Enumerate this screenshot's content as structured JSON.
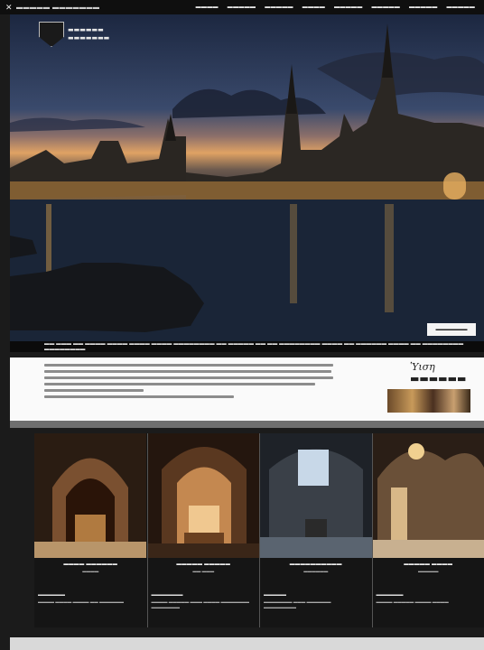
{
  "topbar": {
    "close_glyph": "✕",
    "site_name": "▬▬▬▬▬ ▬▬▬▬▬▬▬",
    "nav": [
      "▬▬▬▬",
      "▬▬▬▬▬",
      "▬▬▬▬▬",
      "▬▬▬▬",
      "▬▬▬▬▬",
      "▬▬▬▬▬",
      "▬▬▬▬▬",
      "▬▬▬▬▬"
    ]
  },
  "hero": {
    "logo_line1": "▬▬▬▬▬▬",
    "logo_line2": "▬▬▬▬▬▬▬",
    "button_label": "▬▬▬▬▬▬▬",
    "caption": "▬▬ ▬▬▬ ▬▬ ▬▬▬▬ ▬▬▬▬ ▬▬▬▬ ▬▬▬▬ ▬▬▬▬▬▬▬▬ ▬▬ ▬▬▬▬▬ ▬▬ ▬▬ ▬▬▬▬▬▬▬▬ ▬▬▬▬ ▬▬ ▬▬▬▬▬▬ ▬▬▬▬ ▬▬ ▬▬▬▬▬▬▬▬ ▬▬▬▬▬▬▬▬"
  },
  "intro": {
    "title": "Ὑιση ▬▬▬▬▬▬"
  },
  "gallery": [
    {
      "caption": "▬▬▬▬ ▬▬▬▬▬▬",
      "sub": "▬▬▬▬",
      "desc_title": "▬▬▬▬▬▬",
      "desc": "▬▬▬▬ ▬▬▬▬ ▬▬▬▬ ▬▬ ▬▬▬▬▬▬"
    },
    {
      "caption": "▬▬▬▬▬ ▬▬▬▬▬",
      "sub": "▬▬ ▬▬▬",
      "desc_title": "▬▬▬▬▬▬▬",
      "desc": "▬▬▬▬ ▬▬▬▬▬ ▬▬▬ ▬▬▬▬ ▬▬▬▬▬▬▬ ▬▬▬▬▬▬▬"
    },
    {
      "caption": "▬▬▬▬▬▬▬▬▬▬",
      "sub": "▬▬▬▬▬▬",
      "desc_title": "▬▬▬▬▬",
      "desc": "▬▬▬▬▬▬▬ ▬▬▬ ▬▬▬▬▬▬ ▬▬▬▬▬▬▬▬"
    },
    {
      "caption": "▬▬▬▬▬ ▬▬▬▬",
      "sub": "▬▬▬▬▬",
      "desc_title": "▬▬▬▬▬▬",
      "desc": "▬▬▬▬ ▬▬▬▬▬ ▬▬▬▬ ▬▬▬▬"
    }
  ],
  "colors": {
    "page_bg": "#1b1b1b",
    "intro_bg": "#fafafa",
    "separator": "#6f6f6f"
  }
}
